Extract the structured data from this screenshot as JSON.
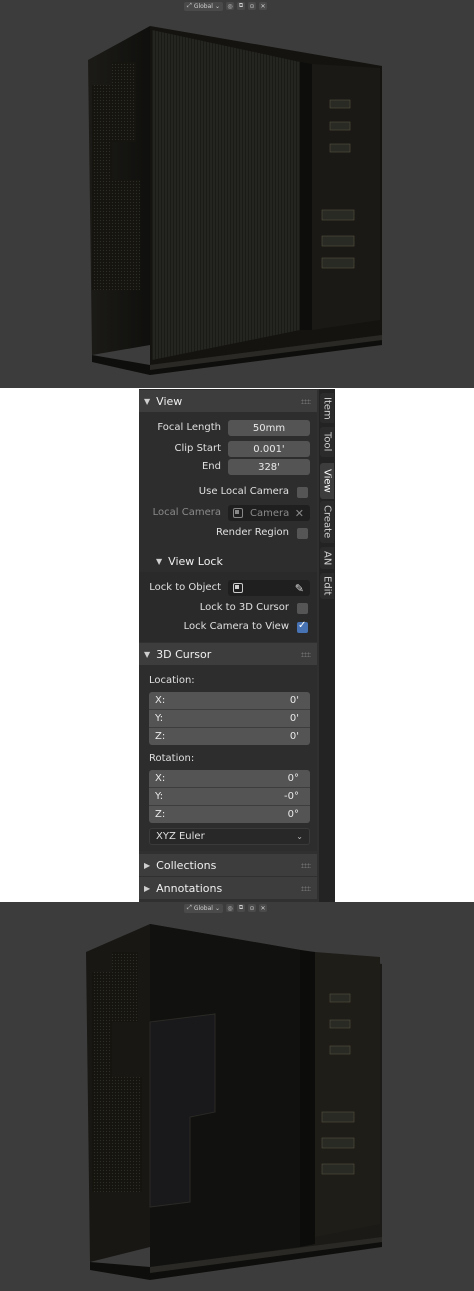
{
  "viewport_header": {
    "orientation": "Global",
    "icons": [
      "transform-orientation-icon",
      "pivot-icon",
      "snap-icon",
      "proportional-edit-icon",
      "overlay-icon"
    ]
  },
  "sidebar": {
    "tabs": [
      "Item",
      "Tool",
      "View",
      "Create",
      "AN",
      "Edit"
    ],
    "active_tab": "View",
    "view_panel": {
      "title": "View",
      "focal_length_label": "Focal Length",
      "focal_length_value": "50mm",
      "clip_start_label": "Clip Start",
      "clip_start_value": "0.001'",
      "end_label": "End",
      "end_value": "328'",
      "use_local_camera_label": "Use Local Camera",
      "use_local_camera_checked": false,
      "local_camera_label": "Local Camera",
      "local_camera_value": "Camera",
      "render_region_label": "Render Region",
      "render_region_checked": false
    },
    "view_lock_panel": {
      "title": "View Lock",
      "lock_to_object_label": "Lock to Object",
      "lock_to_3d_cursor_label": "Lock to 3D Cursor",
      "lock_to_3d_cursor_checked": false,
      "lock_camera_to_view_label": "Lock Camera to View",
      "lock_camera_to_view_checked": true
    },
    "cursor_panel": {
      "title": "3D Cursor",
      "location_label": "Location:",
      "location": [
        {
          "axis": "X:",
          "value": "0'"
        },
        {
          "axis": "Y:",
          "value": "0'"
        },
        {
          "axis": "Z:",
          "value": "0'"
        }
      ],
      "rotation_label": "Rotation:",
      "rotation": [
        {
          "axis": "X:",
          "value": "0°"
        },
        {
          "axis": "Y:",
          "value": "-0°"
        },
        {
          "axis": "Z:",
          "value": "0°"
        }
      ],
      "rotation_mode": "XYZ Euler"
    },
    "collections_title": "Collections",
    "annotations_title": "Annotations"
  },
  "colors": {
    "viewport_bg": "#3c3c3c",
    "panel_bg": "#303030",
    "accent": "#4772b3"
  }
}
